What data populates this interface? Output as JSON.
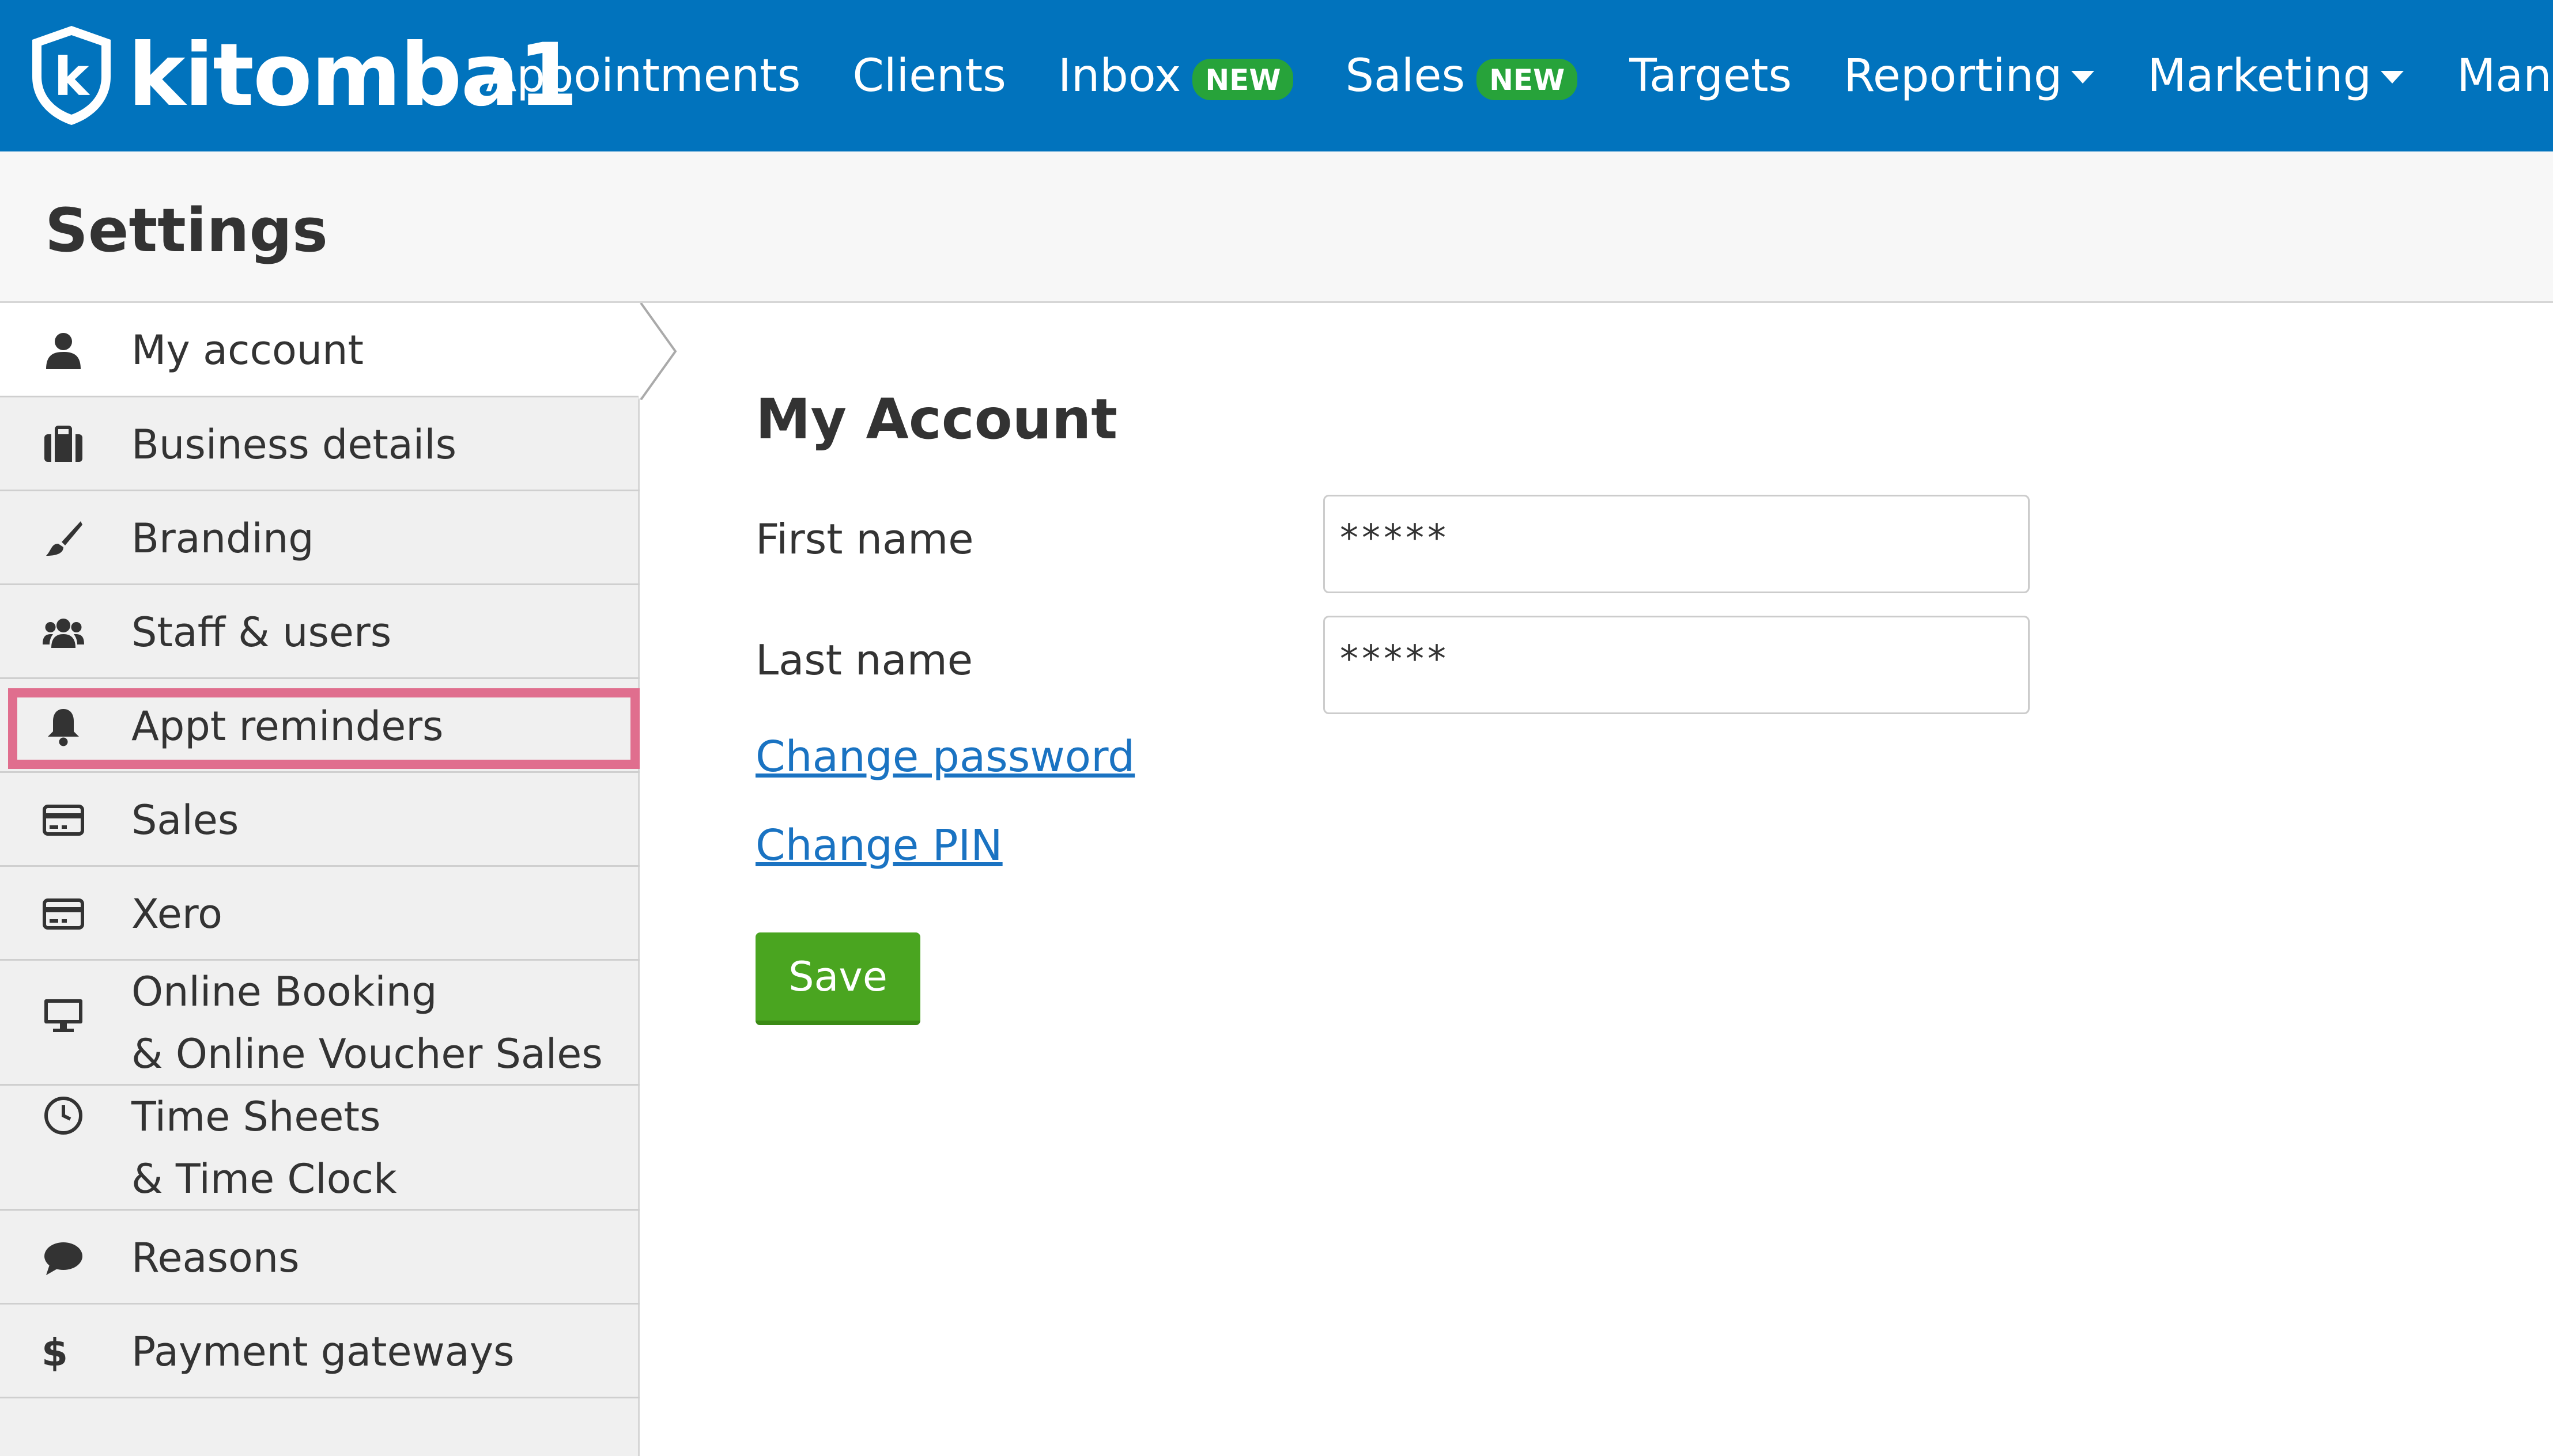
{
  "app": {
    "brand": "kitomba1"
  },
  "nav": {
    "items": [
      {
        "label": "Appointments"
      },
      {
        "label": "Clients"
      },
      {
        "label": "Inbox",
        "badge": "NEW"
      },
      {
        "label": "Sales",
        "badge": "NEW"
      },
      {
        "label": "Targets"
      },
      {
        "label": "Reporting",
        "dropdown": true
      },
      {
        "label": "Marketing",
        "dropdown": true
      },
      {
        "label": "Manage",
        "dropdown": true
      }
    ]
  },
  "page": {
    "title": "Settings"
  },
  "sidebar": {
    "active_index": 0,
    "highlighted_index": 4,
    "items": [
      {
        "label": "My account",
        "icon": "user-icon"
      },
      {
        "label": "Business details",
        "icon": "briefcase-icon"
      },
      {
        "label": "Branding",
        "icon": "paintbrush-icon"
      },
      {
        "label": "Staff & users",
        "icon": "users-icon"
      },
      {
        "label": "Appt reminders",
        "icon": "bell-icon"
      },
      {
        "label": "Sales",
        "icon": "credit-card-icon"
      },
      {
        "label": "Xero",
        "icon": "credit-card-icon"
      },
      {
        "label": "Online Booking",
        "label2": "& Online Voucher Sales",
        "icon": "desktop-icon"
      },
      {
        "label": "Time Sheets",
        "label2": "& Time Clock",
        "icon": "clock-icon"
      },
      {
        "label": "Reasons",
        "icon": "comment-icon"
      },
      {
        "label": "Payment gateways",
        "icon": "dollar-icon"
      }
    ]
  },
  "form": {
    "title": "My Account",
    "first_name": {
      "label": "First name",
      "value": "*****"
    },
    "last_name": {
      "label": "Last name",
      "value": "*****"
    },
    "change_password": "Change password",
    "change_pin": "Change PIN",
    "save_label": "Save"
  },
  "colors": {
    "nav_bg": "#0173bd",
    "badge": "#27a33a",
    "save": "#4aa520",
    "link": "#1a73c2",
    "highlight": "#e06e8e"
  }
}
